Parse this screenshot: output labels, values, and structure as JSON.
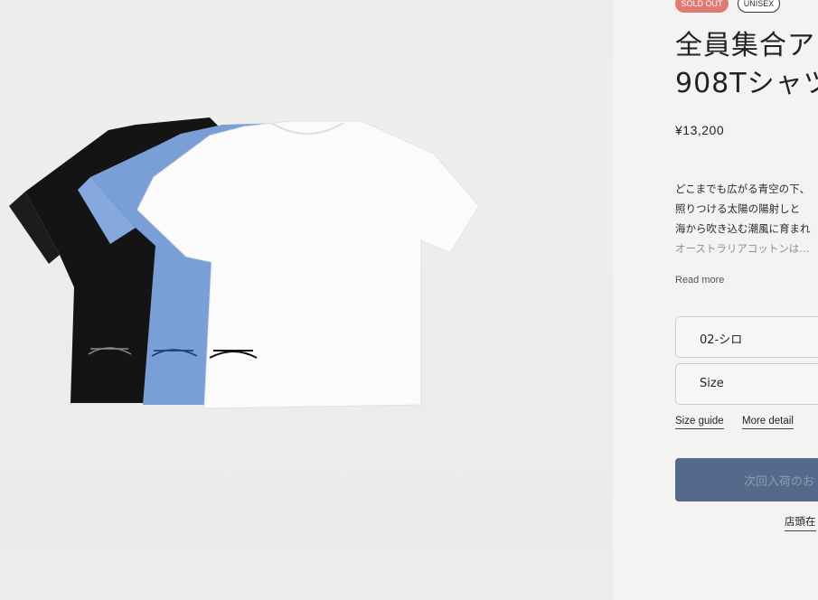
{
  "badges": {
    "sold_out": "SOLD OUT",
    "unisex": "UNISEX"
  },
  "product": {
    "title_line1": "全員集合ア",
    "title_line2": "908Tシャツ",
    "price": "¥13,200"
  },
  "description": {
    "line1": "どこまでも広がる青空の下、",
    "line2": "照りつける太陽の陽射しと",
    "line3": "海から吹き込む潮風に育まれ",
    "line4": "オーストラリアコットンは..."
  },
  "read_more": "Read more",
  "options": {
    "color_value": "02-シロ",
    "size_placeholder": "Size"
  },
  "links": {
    "size_guide": "Size guide",
    "more_detail": "More detail"
  },
  "cta_label": "次回入荷のお",
  "store_link": "店頭在",
  "colors": {
    "accent": "#55698a",
    "sold_out": "#e07a73",
    "tshirt_blue": "#7a9fd6",
    "tshirt_black": "#141414"
  }
}
